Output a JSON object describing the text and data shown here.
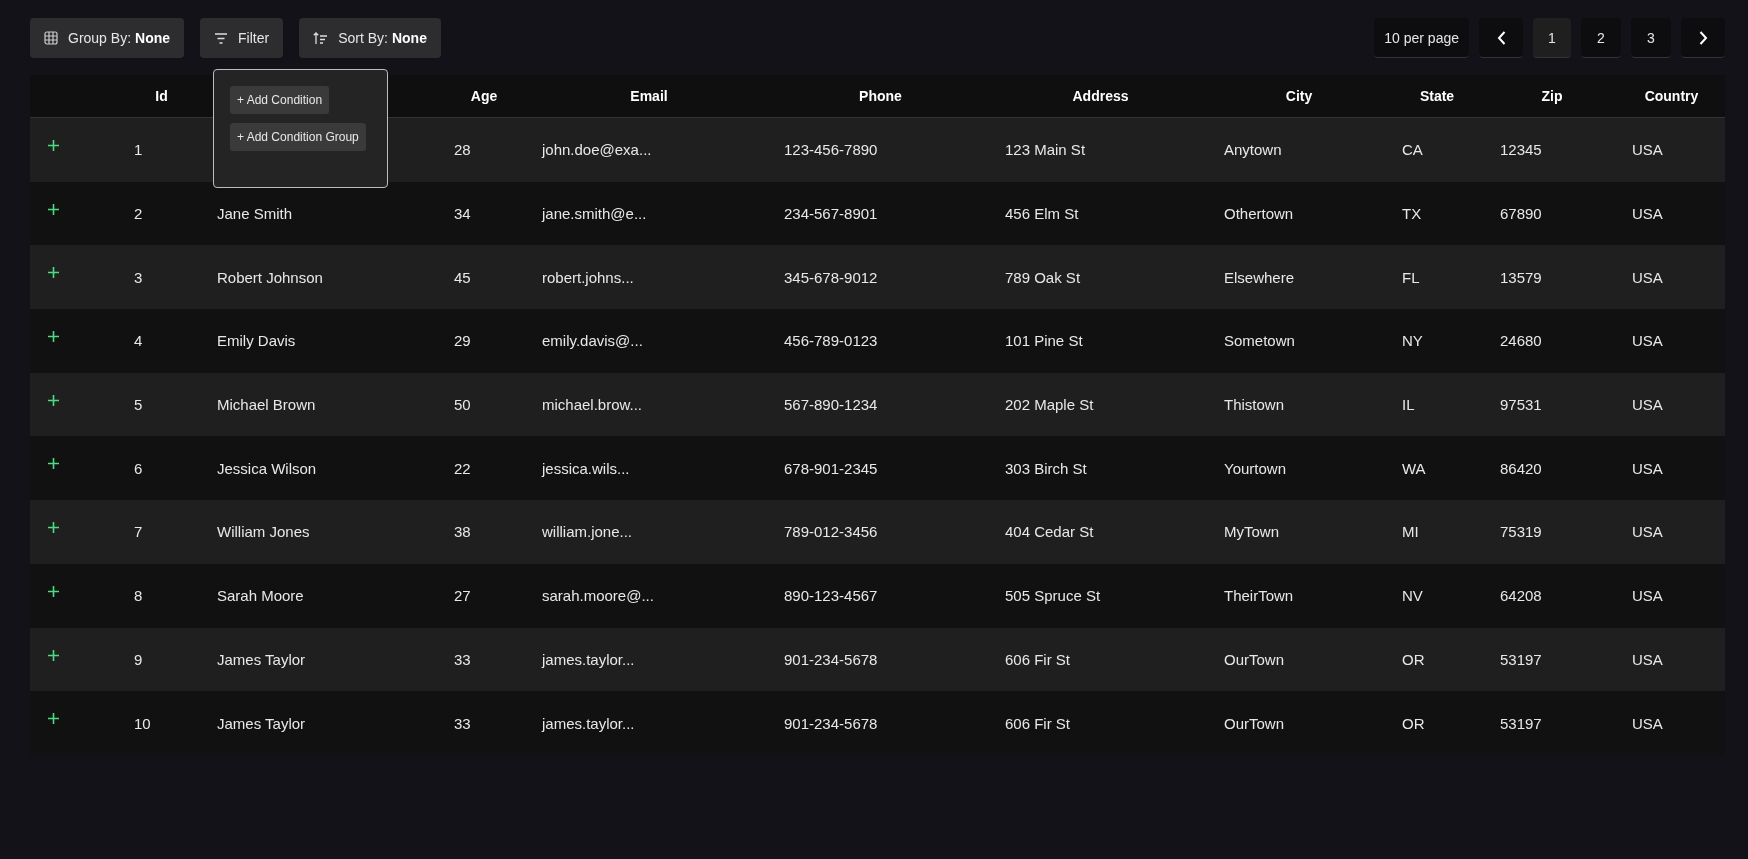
{
  "toolbar": {
    "group_by": {
      "label": "Group By:",
      "value": "None"
    },
    "filter": {
      "label": "Filter"
    },
    "sort_by": {
      "label": "Sort By:",
      "value": "None"
    }
  },
  "filter_popover": {
    "open": true,
    "buttons": [
      "+ Add Condition",
      "+ Add Condition Group"
    ]
  },
  "pagination": {
    "per_page": "10 per page",
    "pages": [
      {
        "label": "1",
        "selected": true
      },
      {
        "label": "2",
        "selected": false
      },
      {
        "label": "3",
        "selected": false
      }
    ]
  },
  "table": {
    "columns": [
      "Id",
      null,
      "Age",
      "Email",
      "Phone",
      "Address",
      "City",
      "State",
      "Zip",
      "Country"
    ],
    "rows": [
      [
        "1",
        null,
        "28",
        "john.doe@exa...",
        "123-456-7890",
        "123 Main St",
        "Anytown",
        "CA",
        "12345",
        "USA"
      ],
      [
        "2",
        "Jane Smith",
        "34",
        "jane.smith@e...",
        "234-567-8901",
        "456 Elm St",
        "Othertown",
        "TX",
        "67890",
        "USA"
      ],
      [
        "3",
        "Robert Johnson",
        "45",
        "robert.johns...",
        "345-678-9012",
        "789 Oak St",
        "Elsewhere",
        "FL",
        "13579",
        "USA"
      ],
      [
        "4",
        "Emily Davis",
        "29",
        "emily.davis@...",
        "456-789-0123",
        "101 Pine St",
        "Sometown",
        "NY",
        "24680",
        "USA"
      ],
      [
        "5",
        "Michael Brown",
        "50",
        "michael.brow...",
        "567-890-1234",
        "202 Maple St",
        "Thistown",
        "IL",
        "97531",
        "USA"
      ],
      [
        "6",
        "Jessica Wilson",
        "22",
        "jessica.wils...",
        "678-901-2345",
        "303 Birch St",
        "Yourtown",
        "WA",
        "86420",
        "USA"
      ],
      [
        "7",
        "William Jones",
        "38",
        "william.jone...",
        "789-012-3456",
        "404 Cedar St",
        "MyTown",
        "MI",
        "75319",
        "USA"
      ],
      [
        "8",
        "Sarah Moore",
        "27",
        "sarah.moore@...",
        "890-123-4567",
        "505 Spruce St",
        "TheirTown",
        "NV",
        "64208",
        "USA"
      ],
      [
        "9",
        "James Taylor",
        "33",
        "james.taylor...",
        "901-234-5678",
        "606 Fir St",
        "OurTown",
        "OR",
        "53197",
        "USA"
      ],
      [
        "10",
        "James Taylor",
        "33",
        "james.taylor...",
        "901-234-5678",
        "606 Fir St",
        "OurTown",
        "OR",
        "53197",
        "USA"
      ]
    ]
  }
}
